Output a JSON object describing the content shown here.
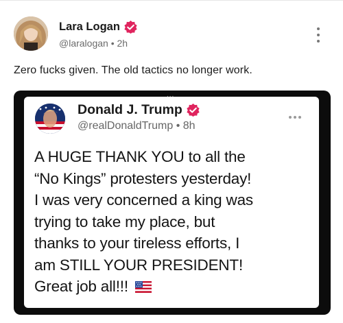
{
  "post": {
    "author_name": "Lara Logan",
    "handle": "@laralogan",
    "separator": "•",
    "time": "2h",
    "text": "Zero fucks given. The old tactics no longer work.",
    "divider": "...",
    "colors": {
      "verified_badge": "#e0245e",
      "dots": "#777777"
    }
  },
  "embedded_post": {
    "author_name": "Donald J. Trump",
    "handle": "@realDonaldTrump",
    "separator": "•",
    "time": "8h",
    "lines": [
      "A HUGE THANK YOU to all the",
      "“No Kings” protesters yesterday!",
      "I was very concerned a king was",
      "trying to take my place, but",
      "thanks to your tireless efforts, I",
      "am STILL YOUR PRESIDENT!",
      "Great job all!!!"
    ],
    "emoji": "us-flag-icon",
    "colors": {
      "frame": "#0c0c0c",
      "verified_badge": "#e0245e"
    }
  }
}
